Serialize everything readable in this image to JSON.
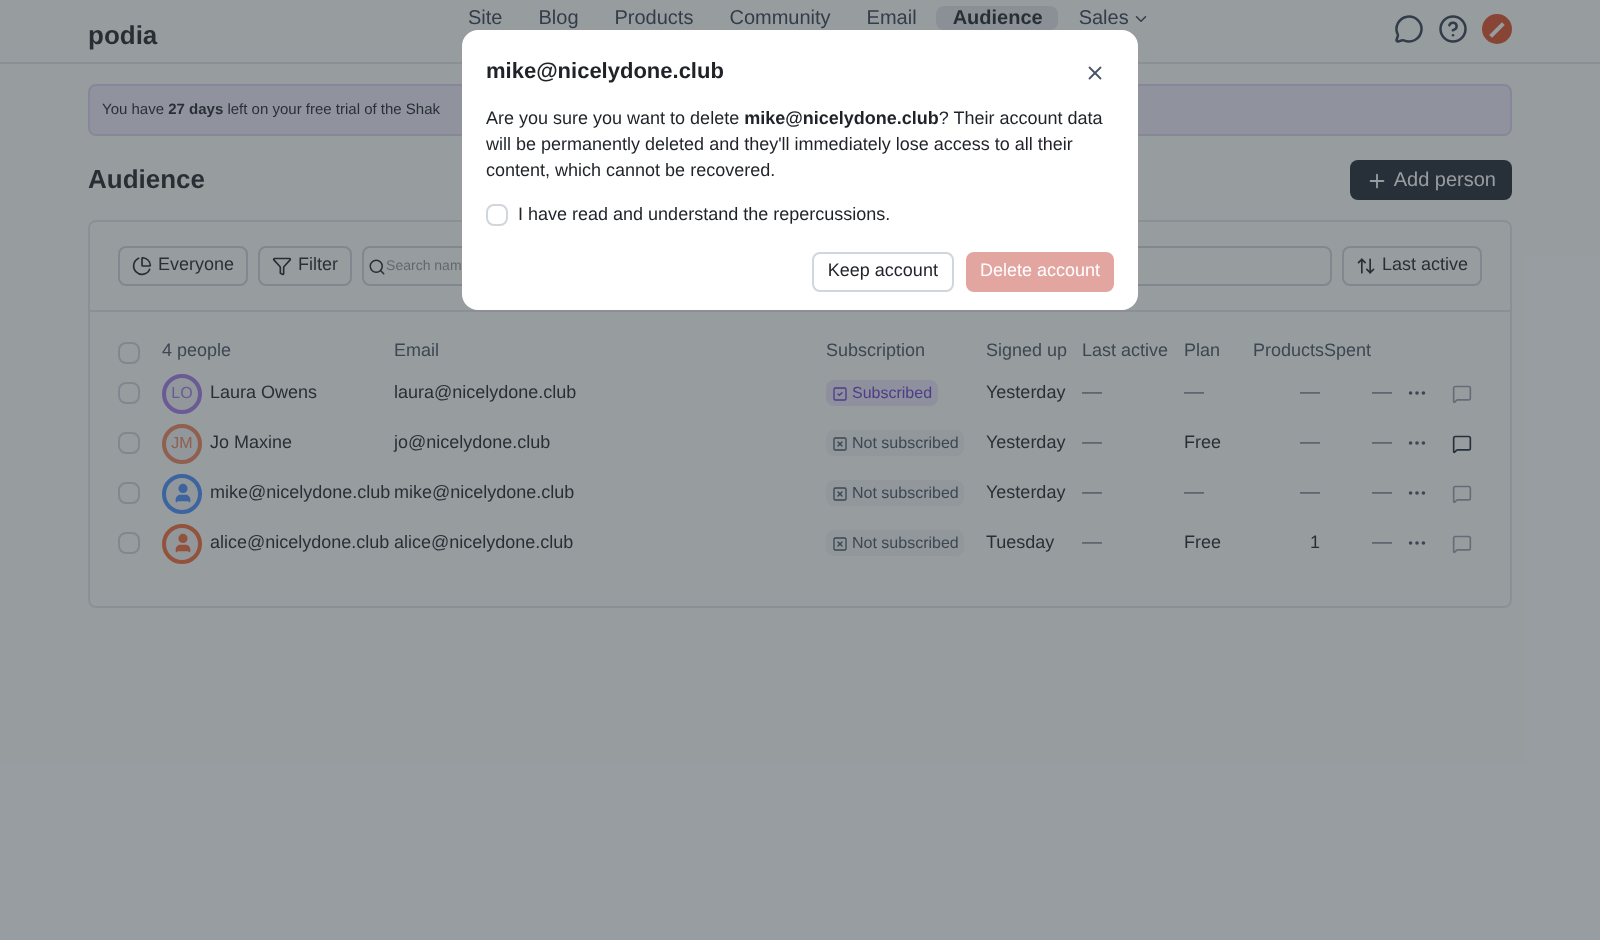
{
  "header": {
    "logo": "podia",
    "nav": [
      {
        "label": "Site",
        "selected": false
      },
      {
        "label": "Blog",
        "selected": false
      },
      {
        "label": "Products",
        "selected": false
      },
      {
        "label": "Community",
        "selected": false
      },
      {
        "label": "Email",
        "selected": false
      },
      {
        "label": "Audience",
        "selected": true
      },
      {
        "label": "Sales",
        "selected": false,
        "dropdown": true
      }
    ]
  },
  "banner": {
    "text": "You have **27 days** left on your free trial of the Shak"
  },
  "page": {
    "title": "Audience",
    "add_button": "Add person"
  },
  "toolbar": {
    "segment": "Everyone",
    "filter": "Filter",
    "search": {
      "placeholder": "Search nam"
    },
    "sort": "Last active"
  },
  "table": {
    "columns": [
      "4 people",
      "Email",
      "Subscription",
      "Signed up",
      "Last active",
      "Plan",
      "Products",
      "Spent"
    ],
    "select_all": {
      "checked": false
    },
    "rows": [
      {
        "checked": false,
        "avatar": {
          "kind": "initials",
          "text": "LO",
          "color": "#6a5a95"
        },
        "name": "Laura Owens",
        "email": "laura@nicelydone.club",
        "subscribed": true,
        "subscription": "Subscribed",
        "signed_up": "Yesterday",
        "last_active": "—",
        "plan": "—",
        "products": "—",
        "spent": "—",
        "messages": false
      },
      {
        "checked": false,
        "avatar": {
          "kind": "initials",
          "text": "JM",
          "color": "#905f4d"
        },
        "name": "Jo Maxine",
        "email": "jo@nicelydone.club",
        "subscribed": false,
        "subscription": "Not subscribed",
        "signed_up": "Yesterday",
        "last_active": "—",
        "plan": "Free",
        "products": "—",
        "spent": "—",
        "messages": true
      },
      {
        "checked": false,
        "avatar": {
          "kind": "user",
          "color": "#3c649e"
        },
        "name": "mike@nicelydone.club",
        "email": "mike@nicelydone.club",
        "subscribed": false,
        "subscription": "Not subscribed",
        "signed_up": "Yesterday",
        "last_active": "—",
        "plan": "—",
        "products": "—",
        "spent": "—",
        "messages": false
      },
      {
        "checked": false,
        "avatar": {
          "kind": "user",
          "color": "#93523c"
        },
        "name": "alice@nicelydone.club",
        "email": "alice@nicelydone.club",
        "subscribed": false,
        "subscription": "Not subscribed",
        "signed_up": "Tuesday",
        "last_active": "—",
        "plan": "Free",
        "products": "1",
        "spent": "—",
        "messages": false
      }
    ]
  },
  "dialog": {
    "title": "mike@nicelydone.club",
    "message": "Are you sure you want to delete **mike@nicelydone.club**? Their account data will be permanently deleted and they'll immediately lose access to all their content, which cannot be recovered.",
    "confirm": {
      "label": "I have read and understand the repercussions.",
      "checked": false
    },
    "cancel": "Keep account",
    "delete": {
      "label": "Delete account",
      "disabled": true
    }
  }
}
